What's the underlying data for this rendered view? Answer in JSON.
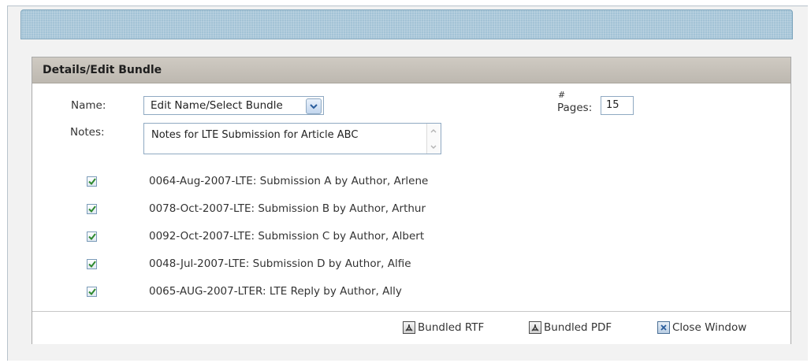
{
  "header": {
    "title": "Details/Edit Bundle"
  },
  "form": {
    "name_label": "Name:",
    "select_value": "Edit Name/Select Bundle",
    "pages_label_top": "#",
    "pages_label_bottom": "Pages:",
    "pages_value": "15",
    "notes_label": "Notes:",
    "notes_value": "Notes for LTE Submission for Article ABC"
  },
  "items": [
    {
      "label": "0064-Aug-2007-LTE: Submission A by Author, Arlene",
      "checked": true
    },
    {
      "label": "0078-Oct-2007-LTE: Submission B by Author, Arthur",
      "checked": true
    },
    {
      "label": "0092-Oct-2007-LTE: Submission C by Author, Albert",
      "checked": true
    },
    {
      "label": "0048-Jul-2007-LTE: Submission D by Author, Alfie",
      "checked": true
    },
    {
      "label": "0065-AUG-2007-LTER: LTE Reply by Author, Ally",
      "checked": true
    }
  ],
  "footer": {
    "rtf_label": "Bundled RTF",
    "pdf_label": "Bundled PDF",
    "close_label": "Close Window"
  },
  "colors": {
    "accent_titlebar": "#a3c3d6",
    "panel_header": "#c6c1b9",
    "check_green": "#2f8a2f"
  },
  "icons": {
    "select_arrow": "chevron-down-icon",
    "check": "checkmark-icon",
    "rtf": "pdf-acrobat-icon",
    "pdf": "pdf-acrobat-icon",
    "close": "close-box-icon"
  }
}
